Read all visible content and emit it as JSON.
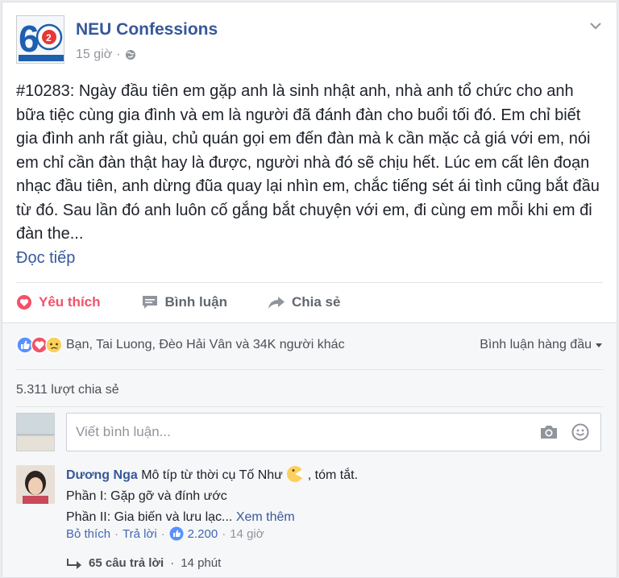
{
  "post": {
    "page_name": "NEU Confessions",
    "time": "15 giờ",
    "separator": "·",
    "text": "#10283: Ngày đầu tiên em gặp anh là sinh nhật anh, nhà anh tổ chức cho anh bữa tiệc cùng gia đình và em là người đã đánh đàn cho buổi tối đó. Em chỉ biết gia đình anh rất giàu, chủ quán gọi em đến đàn mà k cần mặc cả giá với em, nói em chỉ cần đàn thật hay là được, người nhà đó sẽ chịu hết. Lúc em cất lên đoạn nhạc đầu tiên, anh dừng đũa quay lại nhìn em, chắc tiếng sét ái tình cũng bắt đầu từ đó. Sau lần đó anh luôn cố gắng bắt chuyện với em, đi cùng em mỗi khi em đi đàn the...",
    "read_more": "Đọc tiếp"
  },
  "actions": {
    "like": "Yêu thích",
    "comment": "Bình luận",
    "share": "Chia sẻ"
  },
  "reactions": {
    "summary": "Bạn, Tai Luong, Đèo Hải Vân và 34K người khác",
    "sort": "Bình luận hàng đầu",
    "icons": [
      "like-icon",
      "love-icon",
      "sad-icon"
    ]
  },
  "shares": "5.311 lượt chia sẻ",
  "comment_input": {
    "placeholder": "Viết bình luận..."
  },
  "comment": {
    "author": "Dương Nga",
    "line1": "Mô típ từ thời cụ Tố Như",
    "line1_end": ", tóm tắt.",
    "line2": "Phần I: Gặp gỡ và đính ước",
    "line3": "Phần II: Gia biến và lưu lạc...",
    "see_more": "Xem thêm",
    "unlike": "Bỏ thích",
    "reply": "Trả lời",
    "likes": "2.200",
    "time": "14 giờ",
    "sep": "·"
  },
  "replies": {
    "count": "65 câu trả lời",
    "time": "14 phút",
    "sep": "·"
  },
  "colors": {
    "link": "#365899",
    "love": "#f25268",
    "like_blue": "#5890ff"
  }
}
